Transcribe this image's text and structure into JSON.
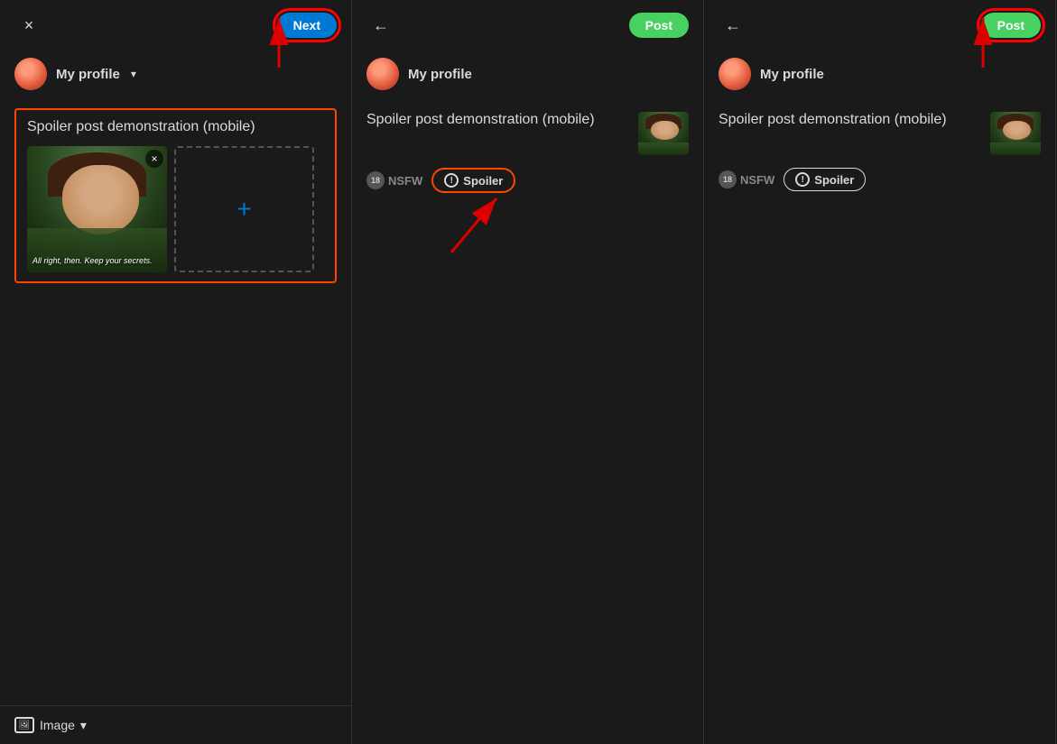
{
  "panels": [
    {
      "id": "panel1",
      "header": {
        "close_label": "×",
        "next_label": "Next",
        "next_btn_type": "blue"
      },
      "profile": {
        "name": "My profile",
        "avatar_emoji": "🧑"
      },
      "post": {
        "title": "Spoiler post demonstration (mobile)",
        "image_caption": "All right, then. Keep your secrets.",
        "close_icon": "×",
        "add_icon": "+"
      },
      "footer": {
        "type_label": "Image",
        "chevron": "∨"
      },
      "arrow_target": "next_button"
    },
    {
      "id": "panel2",
      "header": {
        "back_label": "←",
        "post_label": "Post",
        "post_btn_type": "cyan"
      },
      "profile": {
        "name": "My profile",
        "avatar_emoji": "🧑"
      },
      "post": {
        "title": "Spoiler post demonstration (mobile)"
      },
      "tags": {
        "nsfw_label": "NSFW",
        "nsfw_number": "18",
        "spoiler_label": "Spoiler",
        "spoiler_highlighted": true
      },
      "arrow_target": "spoiler_badge"
    },
    {
      "id": "panel3",
      "header": {
        "back_label": "←",
        "post_label": "Post",
        "post_btn_type": "cyan"
      },
      "profile": {
        "name": "My profile",
        "avatar_emoji": "🧑"
      },
      "post": {
        "title": "Spoiler post demonstration (mobile)"
      },
      "tags": {
        "nsfw_label": "NSFW",
        "nsfw_number": "18",
        "spoiler_label": "Spoiler",
        "spoiler_highlighted": false
      },
      "arrow_target": "post_button"
    }
  ],
  "colors": {
    "background": "#1a1a1b",
    "text_primary": "#d7dadc",
    "text_secondary": "#888",
    "blue": "#0079d3",
    "cyan": "#46d160",
    "red": "#ff4500",
    "red_annotation": "#e00"
  }
}
